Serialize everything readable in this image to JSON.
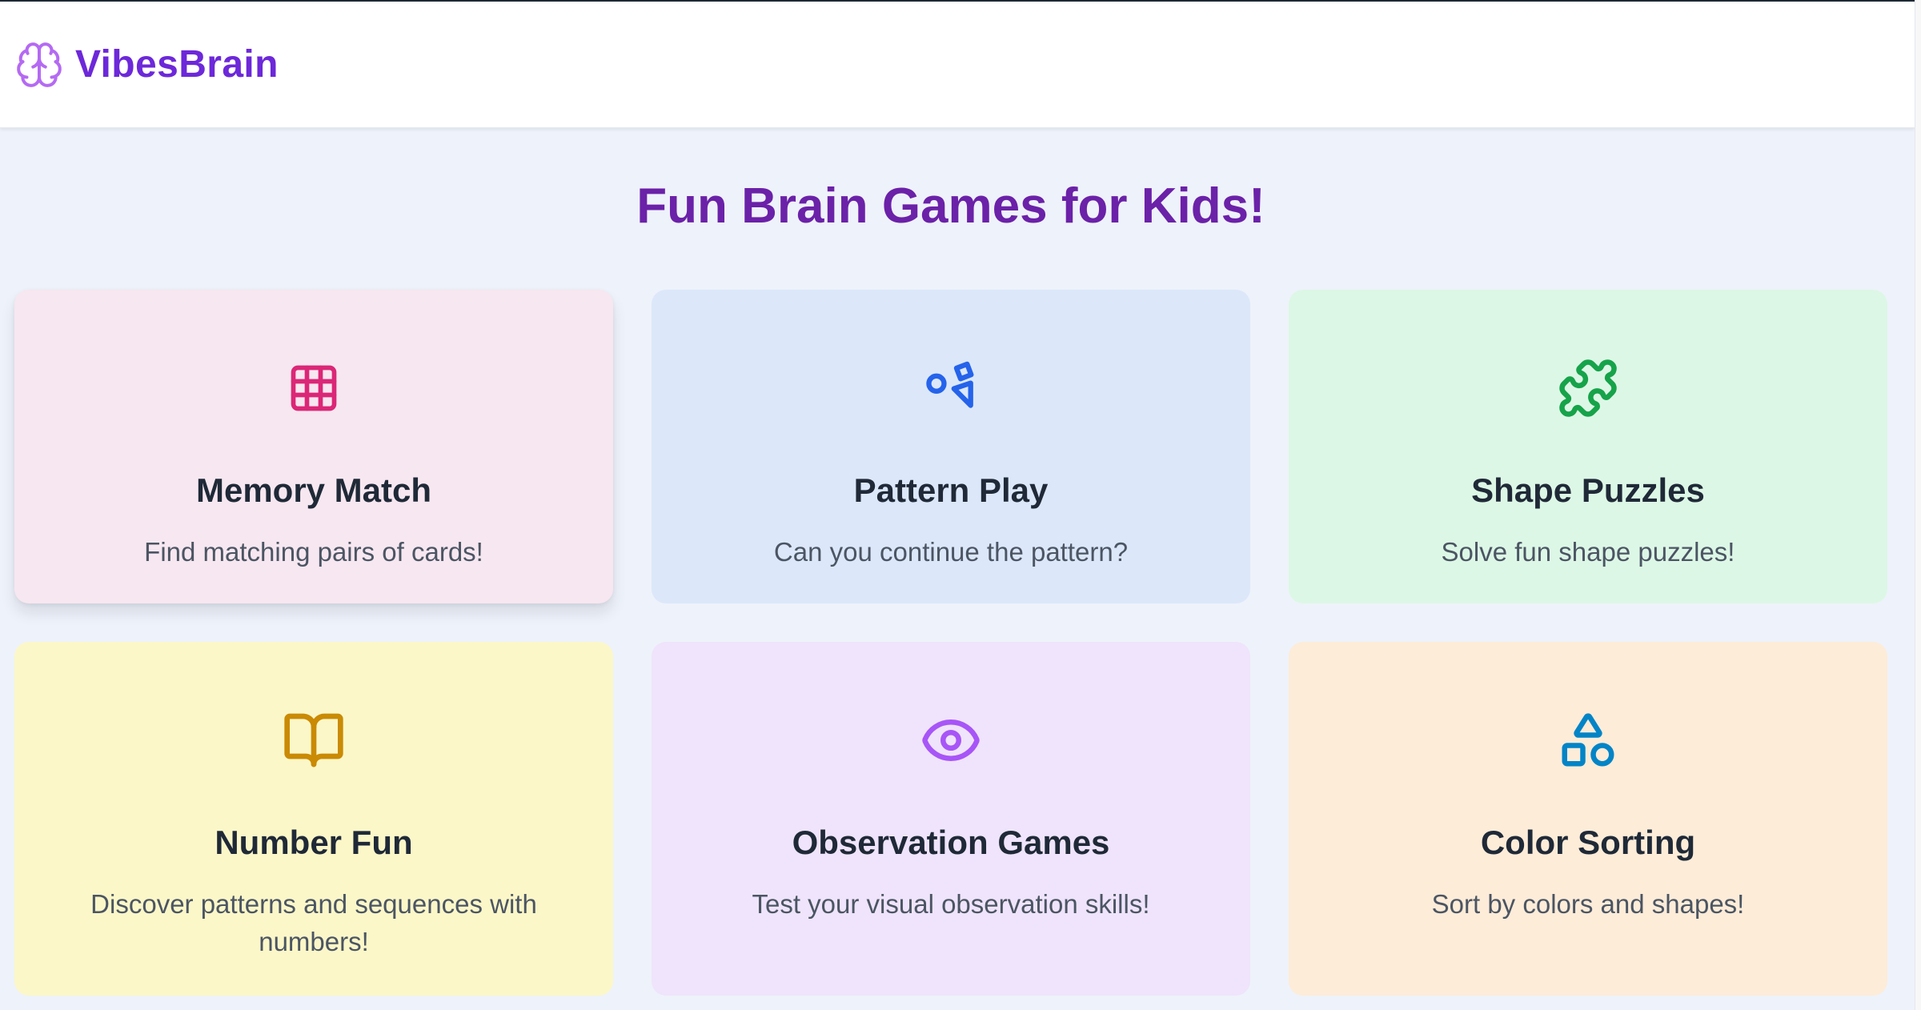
{
  "header": {
    "brand_name": "VibesBrain",
    "brand_icon": "brain-icon"
  },
  "main": {
    "title": "Fun Brain Games for Kids!"
  },
  "games": [
    {
      "title": "Memory Match",
      "description": "Find matching pairs of cards!",
      "icon": "grid-icon",
      "background": "#f7e7f0",
      "icon_color": "#db2777"
    },
    {
      "title": "Pattern Play",
      "description": "Can you continue the pattern?",
      "icon": "shapes-icon",
      "background": "#dce7fa",
      "icon_color": "#2563eb"
    },
    {
      "title": "Shape Puzzles",
      "description": "Solve fun shape puzzles!",
      "icon": "puzzle-icon",
      "background": "#ddf7e6",
      "icon_color": "#16a34a"
    },
    {
      "title": "Number Fun",
      "description": "Discover patterns and sequences with numbers!",
      "icon": "book-open-icon",
      "background": "#fcf7c8",
      "icon_color": "#ca8a04"
    },
    {
      "title": "Observation Games",
      "description": "Test your visual observation skills!",
      "icon": "eye-icon",
      "background": "#efe4fb",
      "icon_color": "#9333ea"
    },
    {
      "title": "Color Sorting",
      "description": "Sort by colors and shapes!",
      "icon": "shapes-sort-icon",
      "background": "#fdecd8",
      "icon_color": "#0284c7"
    }
  ]
}
